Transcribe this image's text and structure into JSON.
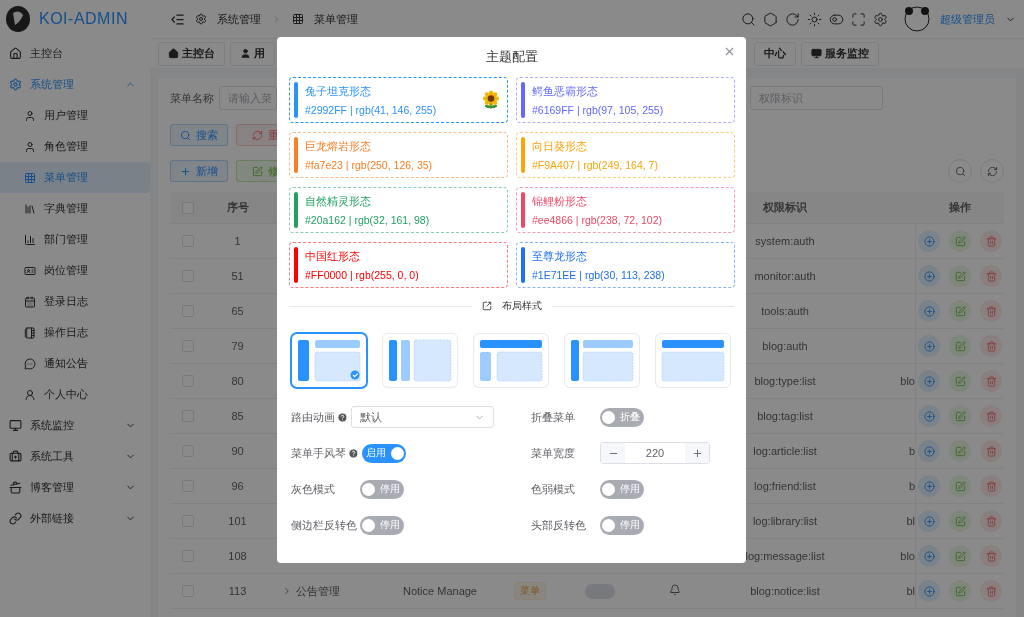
{
  "sidebar": {
    "logo": "KOI-ADMIN",
    "items": [
      {
        "label": "主控台",
        "selected": false
      },
      {
        "label": "系统管理",
        "selected": false,
        "expanded": true,
        "children": [
          {
            "label": "用户管理",
            "selected": false
          },
          {
            "label": "角色管理",
            "selected": false
          },
          {
            "label": "菜单管理",
            "selected": true
          },
          {
            "label": "字典管理",
            "selected": false
          },
          {
            "label": "部门管理",
            "selected": false
          },
          {
            "label": "岗位管理",
            "selected": false
          },
          {
            "label": "登录日志",
            "selected": false
          },
          {
            "label": "操作日志",
            "selected": false
          },
          {
            "label": "通知公告",
            "selected": false
          },
          {
            "label": "个人中心",
            "selected": false
          }
        ]
      },
      {
        "label": "系统监控",
        "selected": false,
        "expanded": false
      },
      {
        "label": "系统工具",
        "selected": false,
        "expanded": false
      },
      {
        "label": "博客管理",
        "selected": false,
        "expanded": false
      },
      {
        "label": "外部链接",
        "selected": false,
        "expanded": false
      }
    ]
  },
  "header": {
    "breadcrumb": [
      "系统管理",
      "菜单管理"
    ],
    "user": "超级管理员"
  },
  "tabs": [
    {
      "label": "主控台",
      "selected": false
    },
    {
      "label": "用",
      "selected": false
    },
    {
      "label": "中心",
      "selected": false
    },
    {
      "label": "服务监控",
      "selected": false
    }
  ],
  "search": {
    "label": "菜单名称",
    "placeholder": "请输入菜",
    "perm_placeholder": "权限标识"
  },
  "buttons": [
    {
      "label": "搜索",
      "kind": "search"
    },
    {
      "label": "重",
      "kind": "reset"
    },
    {
      "label": "新增",
      "kind": "add"
    },
    {
      "label": "修",
      "kind": "edit"
    }
  ],
  "table": {
    "columns": [
      "序号",
      "权限标识",
      "操作"
    ],
    "all_checked": false,
    "rows": [
      {
        "checked": false,
        "id": "1",
        "perm": "system:auth"
      },
      {
        "checked": false,
        "id": "51",
        "perm": "monitor:auth"
      },
      {
        "checked": false,
        "id": "65",
        "perm": "tools:auth"
      },
      {
        "checked": false,
        "id": "79",
        "perm": "blog:auth"
      },
      {
        "checked": false,
        "id": "80",
        "perm": "blog:type:list",
        "column_5": "blo"
      },
      {
        "checked": false,
        "id": "85",
        "perm": "blog:tag:list"
      },
      {
        "checked": false,
        "id": "90",
        "perm": "log:article:list",
        "column_5": "b"
      },
      {
        "checked": false,
        "id": "96",
        "perm": "log:friend:list",
        "column_5": "b"
      },
      {
        "checked": false,
        "id": "101",
        "perm": "log:library:list",
        "column_5": "bl"
      },
      {
        "checked": false,
        "id": "108",
        "perm": "log:message:list",
        "column_5": "blo"
      },
      {
        "checked": false,
        "id": "113",
        "name": "公告管理",
        "english": "Notice Manage",
        "tag": "菜单",
        "on": false,
        "perm": "blog:notice:list",
        "column_5": "bl"
      }
    ]
  },
  "modal": {
    "title": "主题配置",
    "themes": [
      {
        "name": "兔子坦克形态",
        "code": "#2992FF | rgb(41, 146, 255)",
        "color": "#2992ff",
        "selected": true
      },
      {
        "name": "鳄鱼恶霸形态",
        "code": "#6169FF | rgb(97, 105, 255)",
        "color": "#6169ff",
        "selected": false
      },
      {
        "name": "巨龙熔岩形态",
        "code": "#fa7e23 | rgb(250, 126, 35)",
        "color": "#fa7e23",
        "selected": false
      },
      {
        "name": "向日葵形态",
        "code": "#F9A407 | rgb(249, 164, 7)",
        "color": "#f9a407",
        "selected": false
      },
      {
        "name": "自然精灵形态",
        "code": "#20a162 | rgb(32, 161, 98)",
        "color": "#20a162",
        "selected": false
      },
      {
        "name": "锦鲤粉形态",
        "code": "#ee4866 | rgb(238, 72, 102)",
        "color": "#ee4866",
        "selected": false
      },
      {
        "name": "中国红形态",
        "code": "#FF0000 | rgb(255, 0, 0)",
        "color": "#ff0000",
        "selected": false
      },
      {
        "name": "至尊龙形态",
        "code": "#1E71EE | rgb(30, 113, 238)",
        "color": "#1e71ee",
        "selected": false
      }
    ],
    "layout_title": "布局样式",
    "layouts": [
      {
        "kind": "vertical",
        "selected": true
      },
      {
        "kind": "columns",
        "selected": false
      },
      {
        "kind": "classic",
        "selected": false
      },
      {
        "kind": "mixed",
        "selected": false
      },
      {
        "kind": "horizontal",
        "selected": false
      }
    ],
    "settings": [
      {
        "label": "路由动画",
        "help": true,
        "kind": "select",
        "value": "默认"
      },
      {
        "label": "折叠菜单",
        "help": false,
        "kind": "switch",
        "on": false,
        "text": "折叠"
      },
      {
        "label": "菜单手风琴",
        "help": true,
        "kind": "switch",
        "on": true,
        "text": "启用"
      },
      {
        "label": "菜单宽度",
        "help": false,
        "kind": "number",
        "value": "220"
      },
      {
        "label": "灰色模式",
        "help": false,
        "kind": "switch",
        "on": false,
        "text": "停用"
      },
      {
        "label": "色弱模式",
        "help": false,
        "kind": "switch",
        "on": false,
        "text": "停用"
      },
      {
        "label": "侧边栏反转色",
        "help": false,
        "kind": "switch",
        "on": false,
        "text": "停用"
      },
      {
        "label": "头部反转色",
        "help": false,
        "kind": "switch",
        "on": false,
        "text": "停用"
      }
    ]
  }
}
